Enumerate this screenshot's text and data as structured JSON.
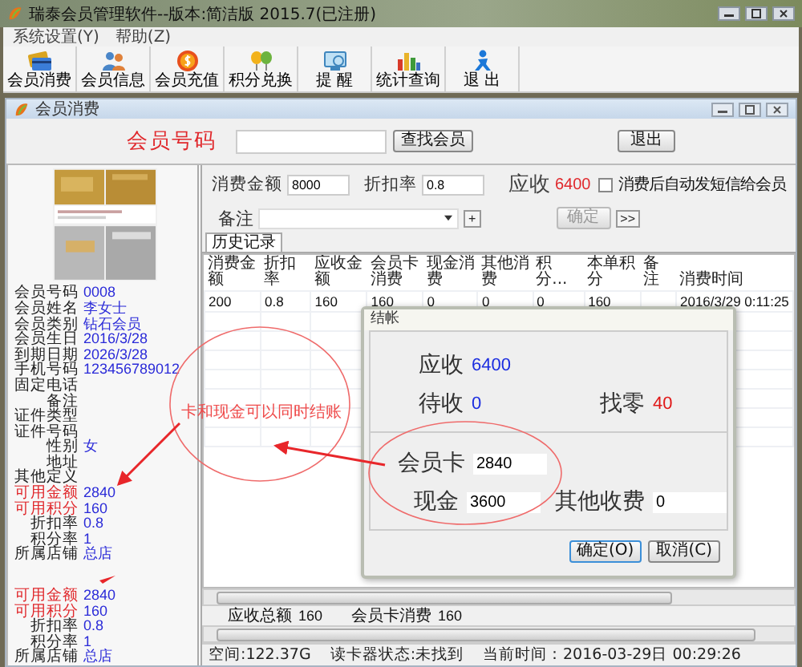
{
  "window": {
    "title": "瑞泰会员管理软件--版本:简洁版 2015.7(已注册)"
  },
  "menu": [
    "系统设置(Y)",
    "帮助(Z)"
  ],
  "toolbar": [
    {
      "label": "会员消费",
      "kind": "card"
    },
    {
      "label": "会员信息",
      "kind": "people"
    },
    {
      "label": "会员充值",
      "kind": "coin"
    },
    {
      "label": "积分兑换",
      "kind": "exchange"
    },
    {
      "label": "提 醒",
      "kind": "reminder"
    },
    {
      "label": "统计查询",
      "kind": "chart"
    },
    {
      "label": "退 出",
      "kind": "exit"
    }
  ],
  "child_window": {
    "title": "会员消费"
  },
  "search": {
    "label": "会员号码",
    "find_button": "查找会员",
    "exit_button": "退出"
  },
  "member_info": [
    {
      "label": "会员号码",
      "value": "0008",
      "highlight": false
    },
    {
      "label": "会员姓名",
      "value": "李女士",
      "highlight": false
    },
    {
      "label": "会员类别",
      "value": "钻石会员",
      "highlight": false
    },
    {
      "label": "会员生日",
      "value": "2016/3/28",
      "highlight": false
    },
    {
      "label": "到期日期",
      "value": "2026/3/28",
      "highlight": false
    },
    {
      "label": "手机号码",
      "value": "123456789012",
      "highlight": false
    },
    {
      "label": "固定电话",
      "highlight": false
    },
    {
      "label": "备注",
      "highlight": false
    },
    {
      "label": "证件类型",
      "highlight": false
    },
    {
      "label": "证件号码",
      "highlight": false
    },
    {
      "label": "性别",
      "value": "女",
      "highlight": false
    },
    {
      "label": "地址",
      "highlight": false
    },
    {
      "label": "其他定义",
      "highlight": false
    },
    {
      "label": "可用金额",
      "value": "2840",
      "highlight": true
    },
    {
      "label": "可用积分",
      "value": "160",
      "highlight": true
    },
    {
      "label": "折扣率",
      "value": "0.8",
      "highlight": false
    },
    {
      "label": "积分率",
      "value": "1",
      "highlight": false
    },
    {
      "label": "所属店铺",
      "value": "总店",
      "highlight": false
    }
  ],
  "member_info_repeat": [
    {
      "label": "可用金额",
      "value": "2840",
      "highlight": true
    },
    {
      "label": "可用积分",
      "value": "160",
      "highlight": true
    },
    {
      "label": "折扣率",
      "value": "0.8",
      "highlight": false
    },
    {
      "label": "积分率",
      "value": "1",
      "highlight": false
    },
    {
      "label": "所属店铺",
      "value": "总店",
      "highlight": false
    }
  ],
  "order": {
    "amount_label": "消费金额",
    "amount": "8000",
    "discount_label": "折扣率",
    "discount": "0.8",
    "due_label": "应收",
    "due": "6400",
    "sms_checkbox": {
      "label": "消费后自动发短信给会员",
      "checked": false
    },
    "note_label": "备注",
    "add_button": "+",
    "confirm_button": {
      "label": "确定",
      "disabled": true
    },
    "more_button": ">>"
  },
  "tabs": [
    {
      "label": "历史记录",
      "selected": true
    }
  ],
  "table": {
    "columns": [
      "消费金额",
      "折扣率",
      "应收金额",
      "会员卡消费",
      "现金消费",
      "其他消费",
      "积分...",
      "本单积分",
      "备注",
      "消费时间"
    ],
    "rows": [
      [
        "200",
        "0.8",
        "160",
        "160",
        "0",
        "0",
        "0",
        "160",
        null,
        "2016/3/29 0:11:25"
      ]
    ]
  },
  "totals": [
    {
      "label": "应收总额",
      "value": "160"
    },
    {
      "label": "会员卡消费",
      "value": "160"
    }
  ],
  "status_bar": [
    "空间:122.37G",
    "读卡器状态:未找到",
    "当前时间：2016-03-29日 00:29:26"
  ],
  "dialog": {
    "title": "结帐",
    "due_label": "应收",
    "due": "6400",
    "pending_label": "待收",
    "pending": "0",
    "change_label": "找零",
    "change": "40",
    "card_label": "会员卡",
    "card": "2840",
    "cash_label": "现金",
    "cash": "3600",
    "other_label": "其他收费",
    "other": "0",
    "ok_button": "确定(O)",
    "cancel_button": "取消(C)"
  },
  "annotation": {
    "text": "卡和现金可以同时结账"
  }
}
